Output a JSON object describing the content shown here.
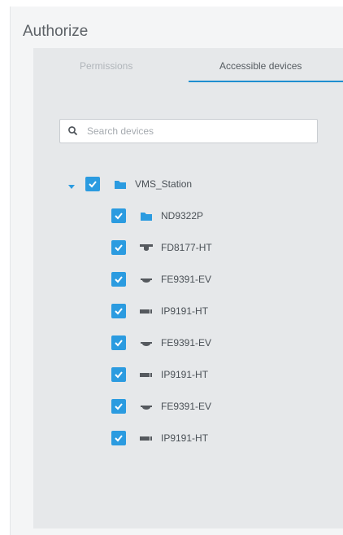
{
  "window": {
    "title": "Authorize"
  },
  "tabs": [
    {
      "label": "Permissions",
      "active": false
    },
    {
      "label": "Accessible devices",
      "active": true
    }
  ],
  "search": {
    "placeholder": "Search devices",
    "value": ""
  },
  "tree": {
    "root": {
      "label": "VMS_Station",
      "checked": true,
      "expanded": true,
      "icon": "folder-icon"
    },
    "children": [
      {
        "label": "ND9322P",
        "checked": true,
        "icon": "folder-icon"
      },
      {
        "label": "FD8177-HT",
        "checked": true,
        "icon": "fixed-dome-camera-icon"
      },
      {
        "label": "FE9391-EV",
        "checked": true,
        "icon": "fisheye-camera-icon"
      },
      {
        "label": "IP9191-HT",
        "checked": true,
        "icon": "bullet-camera-icon"
      },
      {
        "label": "FE9391-EV",
        "checked": true,
        "icon": "fisheye-camera-icon"
      },
      {
        "label": "IP9191-HT",
        "checked": true,
        "icon": "bullet-camera-icon"
      },
      {
        "label": "FE9391-EV",
        "checked": true,
        "icon": "fisheye-camera-icon"
      },
      {
        "label": "IP9191-HT",
        "checked": true,
        "icon": "bullet-camera-icon"
      }
    ]
  },
  "colors": {
    "accent": "#2b9be0",
    "tab_underline": "#1f8fd0"
  }
}
